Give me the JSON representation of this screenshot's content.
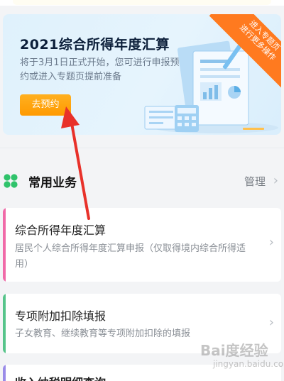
{
  "banner": {
    "title": "2021综合所得年度汇算",
    "description": "将于3月1日正式开始，您可进行申报预约或进入专题页提前准备",
    "reserve_button": "去预约",
    "corner_line1": "进入专题页",
    "corner_line2": "进行更多操作"
  },
  "common_services": {
    "title": "常用业务",
    "manage_label": "管理",
    "chevron": "›"
  },
  "cards": [
    {
      "title": "综合所得年度汇算",
      "description": "居民个人综合所得年度汇算申报（仅取得境内综合所得适用）",
      "accent_color": "#f06aa8"
    },
    {
      "title": "专项附加扣除填报",
      "description": "子女教育、继续教育等专项附加扣除的填报",
      "accent_color": "#56c48a"
    },
    {
      "title": "收入纳税明细查询",
      "accent_color": "#9a8ce8"
    }
  ],
  "watermark": {
    "text": "Bai度经验",
    "sub": "jingyan.baidu.com"
  },
  "colors": {
    "accent_orange": "#ff9a00",
    "annotation_arrow": "#e8312a",
    "clover_green": "#2fc36b"
  }
}
